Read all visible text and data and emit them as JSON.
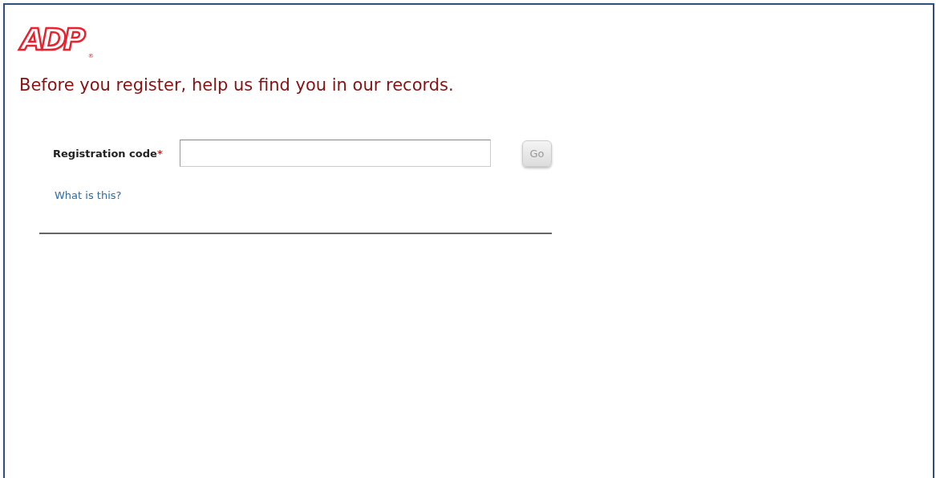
{
  "logo": {
    "text": "ADP",
    "mark": "®"
  },
  "heading": "Before you register, help us find you in our records.",
  "form": {
    "label": "Registration code",
    "required_mark": "*",
    "go_button": {
      "label": "Go",
      "disabled": true
    },
    "help_link": "What is this?"
  }
}
